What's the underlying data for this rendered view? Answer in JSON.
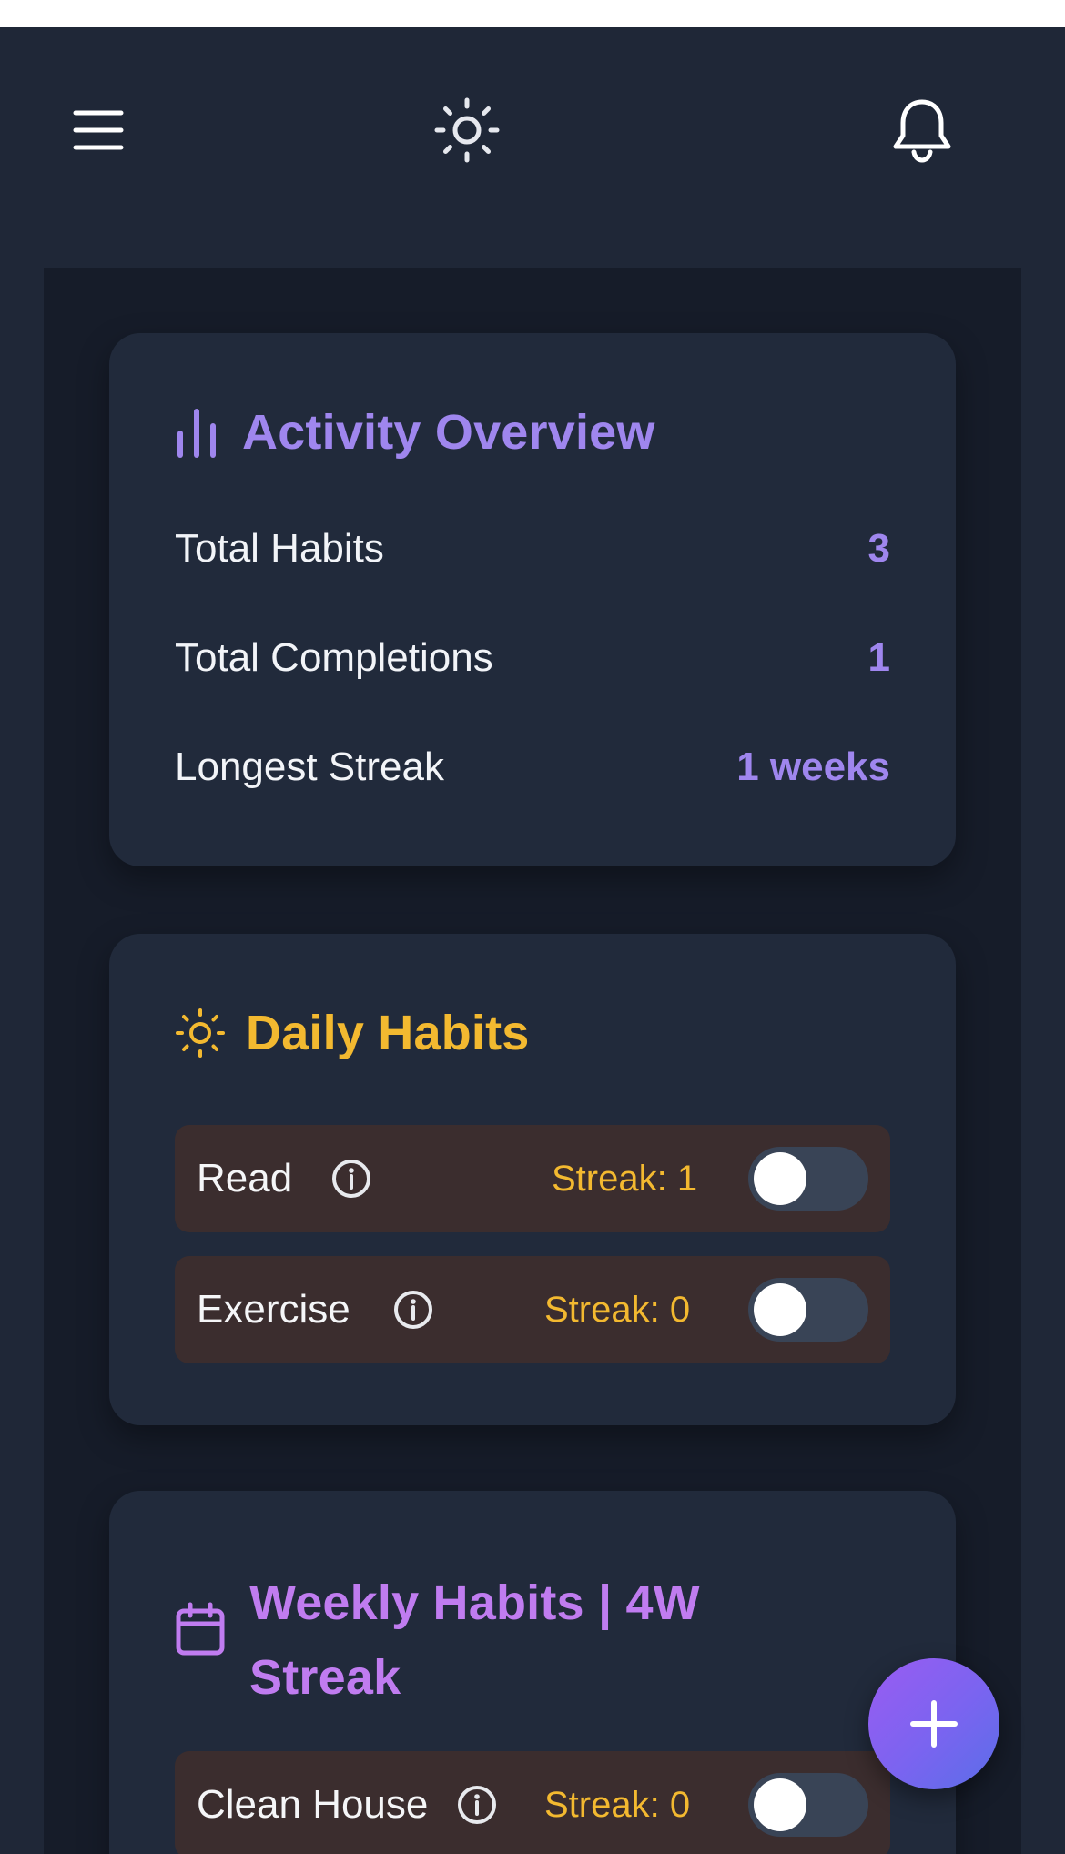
{
  "header": {
    "menu_icon": "hamburger-menu-icon",
    "theme_icon": "sun-icon",
    "notifications_icon": "bell-icon"
  },
  "overview": {
    "title": "Activity Overview",
    "icon": "bar-chart-icon",
    "stats": [
      {
        "label": "Total Habits",
        "value": "3"
      },
      {
        "label": "Total Completions",
        "value": "1"
      },
      {
        "label": "Longest Streak",
        "value": "1 weeks"
      }
    ]
  },
  "daily": {
    "title": "Daily Habits",
    "icon": "sun-icon",
    "habits": [
      {
        "name": "Read",
        "streak": "Streak: 1",
        "done": false
      },
      {
        "name": "Exercise",
        "streak": "Streak: 0",
        "done": false
      }
    ]
  },
  "weekly": {
    "title_line1": "Weekly Habits | 4W",
    "title_line2": "Streak",
    "icon": "calendar-icon",
    "habits": [
      {
        "name": "Clean House",
        "streak": "Streak: 0",
        "done": false
      }
    ]
  },
  "fab": {
    "icon": "plus-icon"
  },
  "colors": {
    "background": "#1f2737",
    "content_bg": "#161c29",
    "card_bg": "#212a3b",
    "overview_accent": "#9f86ee",
    "daily_accent": "#f3b930",
    "weekly_accent": "#c07cf0",
    "habit_row_bg": "#3b2d2e"
  }
}
